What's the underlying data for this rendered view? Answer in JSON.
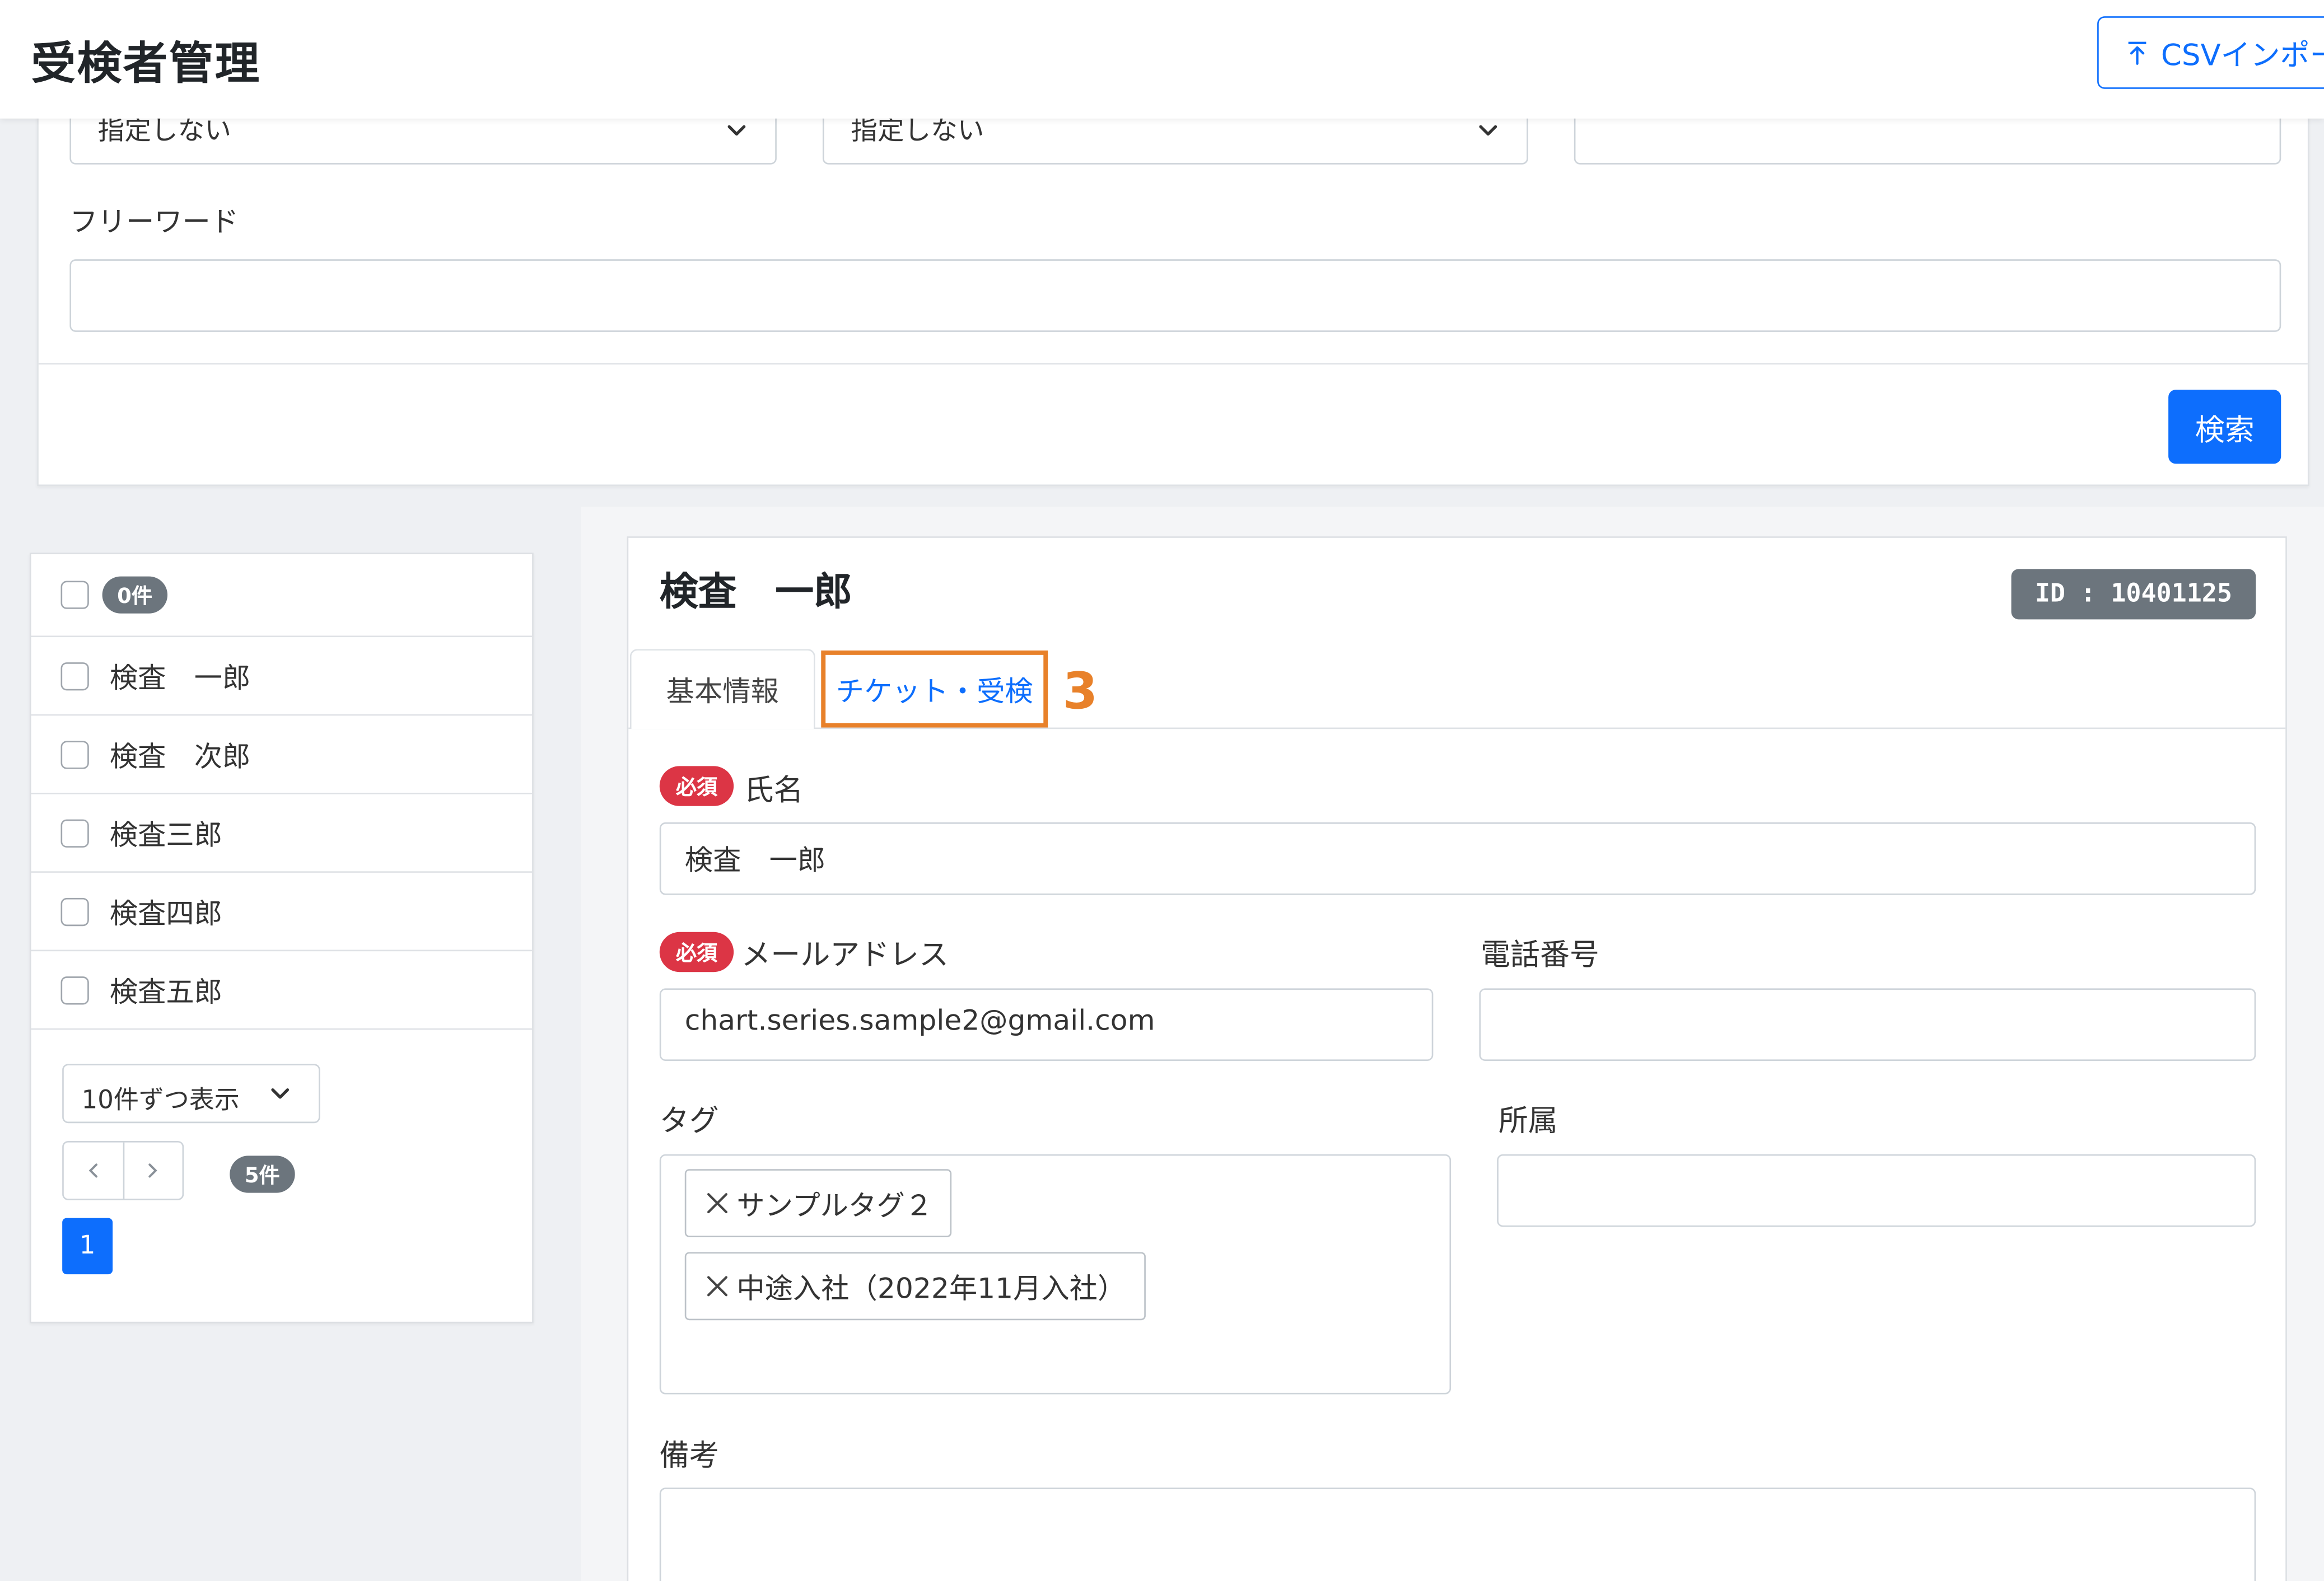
{
  "header": {
    "title": "受検者管理",
    "csv_import_label": "CSVインポート"
  },
  "search": {
    "select1_value": "指定しない",
    "select2_value": "指定しない",
    "select3_value": "",
    "freeword_label": "フリーワード",
    "freeword_value": "",
    "search_button_label": "検索"
  },
  "list": {
    "selected_count": "0件",
    "items": [
      {
        "name": "検査　一郎"
      },
      {
        "name": "検査　次郎"
      },
      {
        "name": "検査三郎"
      },
      {
        "name": "検査四郎"
      },
      {
        "name": "検査五郎"
      }
    ],
    "per_page": "10件ずつ表示",
    "total_count": "5件",
    "current_page": "1"
  },
  "detail": {
    "name": "検査　一郎",
    "id_badge": "ID : 10401125",
    "tabs": [
      {
        "label": "基本情報",
        "active": true
      },
      {
        "label": "チケット・受検",
        "active": false,
        "highlighted": true
      }
    ],
    "step_marker": "3",
    "required_label": "必須",
    "fields": {
      "name_label": "氏名",
      "name_value": "検査　一郎",
      "email_label": "メールアドレス",
      "email_value": "chart.series.sample2@gmail.com",
      "phone_label": "電話番号",
      "phone_value": "",
      "tags_label": "タグ",
      "tags": [
        "サンプルタグ２",
        "中途入社（2022年11月入社）"
      ],
      "affiliation_label": "所属",
      "affiliation_value": "",
      "notes_label": "備考",
      "notes_value": ""
    }
  },
  "colors": {
    "primary": "#0d6efd",
    "required_badge": "#dc3545",
    "badge_gray": "#6c757d",
    "highlight_orange": "#e8812a"
  },
  "icons": [
    "upload-icon",
    "chevron-down-icon",
    "chevron-left-icon",
    "chevron-right-icon",
    "close-icon"
  ]
}
